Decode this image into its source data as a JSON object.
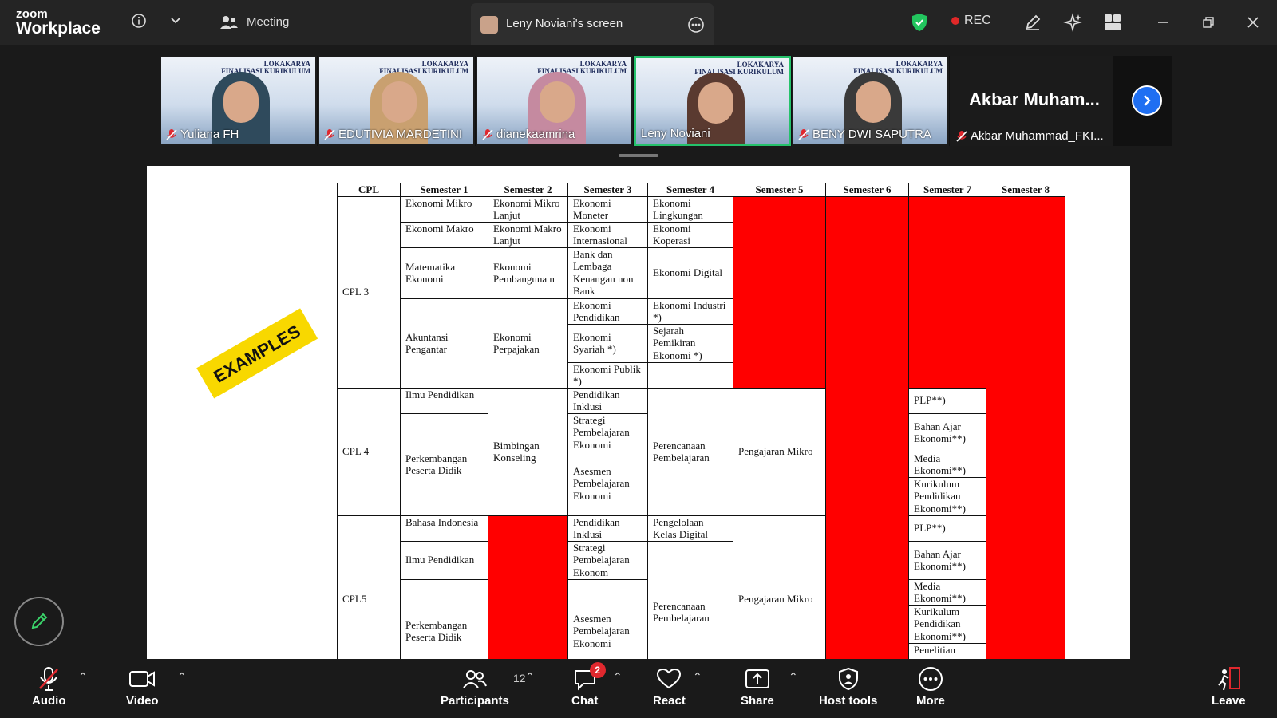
{
  "app": {
    "logo_line1": "zoom",
    "logo_line2": "Workplace"
  },
  "topbar": {
    "meeting_label": "Meeting",
    "screen_tab_label": "Leny Noviani's screen",
    "rec_label": "REC",
    "colors": {
      "shield": "#22c55e",
      "rec_dot": "#e02828"
    }
  },
  "participants": {
    "tiles": [
      {
        "name": "Yuliana FH"
      },
      {
        "name": "EDUTIVIA MARDETINI"
      },
      {
        "name": "dianekaamrina"
      },
      {
        "name": "Leny Noviani"
      },
      {
        "name": "BENY DWI SAPUTRA"
      }
    ],
    "name_only": {
      "big_label": "Akbar  Muham...",
      "name": "Akbar Muhammad_FKI..."
    },
    "banner_line1": "LOKAKARYA",
    "banner_line2": "FINALISASI KURIKULUM",
    "active_color": "#25c26b"
  },
  "document": {
    "sticker": "EXAMPLES",
    "headers": [
      "CPL",
      "Semester 1",
      "Semester 2",
      "Semester 3",
      "Semester 4",
      "Semester 5",
      "Semester 6",
      "Semester 7",
      "Semester 8"
    ],
    "cpl3": {
      "label": "CPL 3",
      "s1": [
        "Ekonomi Mikro",
        "Ekonomi Makro",
        "Matematika Ekonomi",
        "Akuntansi Pengantar"
      ],
      "s2": [
        "Ekonomi Mikro Lanjut",
        "Ekonomi Makro Lanjut",
        "Ekonomi Pembanguna n",
        "Ekonomi Perpajakan"
      ],
      "s3": [
        "Ekonomi Moneter",
        "Ekonomi Internasional",
        "Bank dan Lembaga Keuangan non Bank",
        "Ekonomi Pendidikan",
        "Ekonomi Syariah *)",
        "Ekonomi Publik *)"
      ],
      "s4": [
        "Ekonomi Lingkungan",
        "Ekonomi Koperasi",
        "Ekonomi Digital",
        "Ekonomi Industri *)",
        "Sejarah Pemikiran Ekonomi *)"
      ]
    },
    "cpl4": {
      "label": "CPL 4",
      "s1": [
        "Ilmu Pendidikan",
        "Perkembangan Peserta Didik"
      ],
      "s2": [
        "Bimbingan Konseling"
      ],
      "s3": [
        "Pendidikan Inklusi",
        "Strategi Pembelajaran Ekonomi",
        "Asesmen Pembelajaran Ekonomi"
      ],
      "s4": [
        "Perencanaan Pembelajaran"
      ],
      "s5": [
        "Pengajaran Mikro"
      ],
      "s7": [
        "PLP**)",
        "Bahan Ajar Ekonomi**)",
        "Media Ekonomi**)",
        "Kurikulum Pendidikan Ekonomi**)"
      ]
    },
    "cpl5": {
      "label": "CPL5",
      "s1": [
        "Bahasa Indonesia",
        "Ilmu Pendidikan",
        "Perkembangan Peserta Didik"
      ],
      "s3": [
        "Pendidikan Inklusi",
        "Strategi Pembelajaran Ekonom",
        "Asesmen Pembelajaran Ekonomi"
      ],
      "s4": [
        "Pengelolaan Kelas Digital",
        "Perencanaan Pembelajaran"
      ],
      "s5": [
        "Pengajaran Mikro"
      ],
      "s7": [
        "PLP**)",
        "Bahan Ajar Ekonomi**)",
        "Media Ekonomi**)",
        "Kurikulum Pendidikan Ekonomi**)",
        "Penelitian"
      ]
    },
    "colors": {
      "red_cell": "#ff0000",
      "sticker": "#f8d800"
    }
  },
  "toolbar": {
    "audio": "Audio",
    "video": "Video",
    "participants": "Participants",
    "participants_count": "12",
    "chat": "Chat",
    "chat_badge": "2",
    "react": "React",
    "share": "Share",
    "host_tools": "Host tools",
    "more": "More",
    "leave": "Leave",
    "colors": {
      "audio_muted": "#e0282e",
      "leave": "#e0282e"
    }
  }
}
